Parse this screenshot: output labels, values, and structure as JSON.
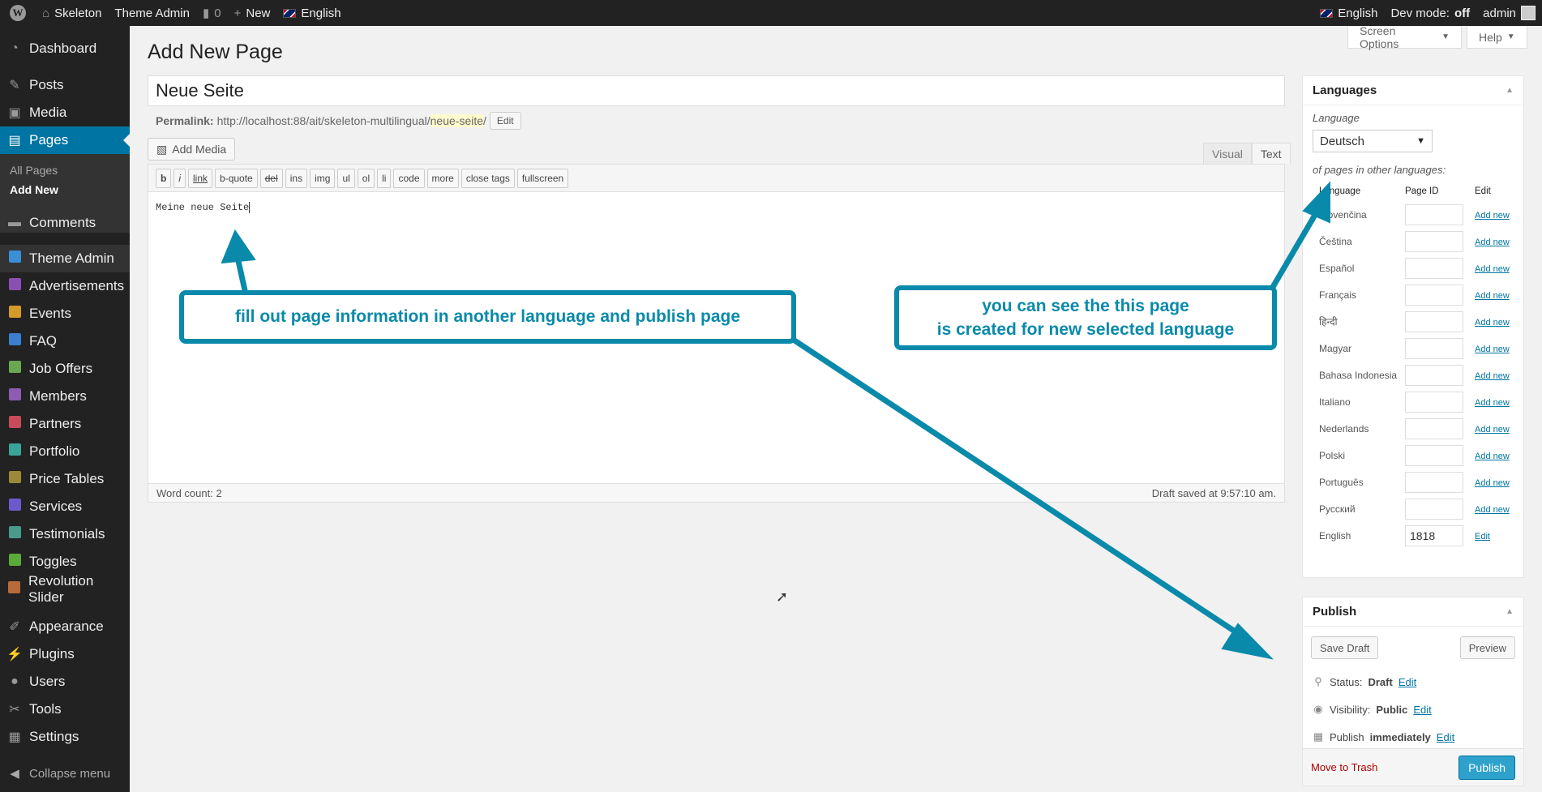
{
  "adminbar": {
    "site_name": "Skeleton",
    "theme_admin": "Theme Admin",
    "comments_count": "0",
    "new_label": "New",
    "language": "English",
    "right_language": "English",
    "dev_mode_label": "Dev mode:",
    "dev_mode_value": "off",
    "user": "admin"
  },
  "sidebar": {
    "items": [
      {
        "label": "Dashboard",
        "icon": "dashboard-icon"
      },
      {
        "label": "Posts",
        "icon": "pin-icon"
      },
      {
        "label": "Media",
        "icon": "media-icon"
      },
      {
        "label": "Pages",
        "icon": "pages-icon"
      },
      {
        "label": "Comments",
        "icon": "comment-icon"
      },
      {
        "label": "Theme Admin",
        "icon": "theme-admin-icon"
      },
      {
        "label": "Advertisements",
        "icon": "advertisements-icon"
      },
      {
        "label": "Events",
        "icon": "events-icon"
      },
      {
        "label": "FAQ",
        "icon": "faq-icon"
      },
      {
        "label": "Job Offers",
        "icon": "job-offers-icon"
      },
      {
        "label": "Members",
        "icon": "members-icon"
      },
      {
        "label": "Partners",
        "icon": "partners-icon"
      },
      {
        "label": "Portfolio",
        "icon": "portfolio-icon"
      },
      {
        "label": "Price Tables",
        "icon": "price-tables-icon"
      },
      {
        "label": "Services",
        "icon": "services-icon"
      },
      {
        "label": "Testimonials",
        "icon": "testimonials-icon"
      },
      {
        "label": "Toggles",
        "icon": "toggles-icon"
      },
      {
        "label": "Revolution Slider",
        "icon": "slider-icon"
      },
      {
        "label": "Appearance",
        "icon": "brush-icon"
      },
      {
        "label": "Plugins",
        "icon": "plugin-icon"
      },
      {
        "label": "Users",
        "icon": "user-icon"
      },
      {
        "label": "Tools",
        "icon": "wrench-icon"
      },
      {
        "label": "Settings",
        "icon": "settings-icon"
      }
    ],
    "submenu": [
      "All Pages",
      "Add New"
    ],
    "collapse_label": "Collapse menu"
  },
  "header": {
    "screen_options": "Screen Options",
    "help": "Help",
    "title": "Add New Page"
  },
  "editor": {
    "post_title": "Neue Seite",
    "permalink_label": "Permalink:",
    "permalink_base": "http://localhost:88/ait/skeleton-multilingual/",
    "permalink_slug": "neue-seite",
    "permalink_end": "/",
    "permalink_edit": "Edit",
    "add_media": "Add Media",
    "tab_visual": "Visual",
    "tab_text": "Text",
    "quicktags": [
      "b",
      "i",
      "link",
      "b-quote",
      "del",
      "ins",
      "img",
      "ul",
      "ol",
      "li",
      "code",
      "more",
      "close tags",
      "fullscreen"
    ],
    "content": "Meine neue Seite",
    "word_count": "Word count: 2",
    "draft_saved": "Draft saved at 9:57:10 am."
  },
  "languages_box": {
    "title": "Languages",
    "language_label": "Language",
    "selected_language": "Deutsch",
    "list_label": "of pages in other languages:",
    "col_language": "Language",
    "col_page_id": "Page ID",
    "col_edit": "Edit",
    "rows": [
      {
        "language": "Slovenčina",
        "page_id": "",
        "action": "Add new"
      },
      {
        "language": "Čeština",
        "page_id": "",
        "action": "Add new"
      },
      {
        "language": "Español",
        "page_id": "",
        "action": "Add new"
      },
      {
        "language": "Français",
        "page_id": "",
        "action": "Add new"
      },
      {
        "language": "हिन्दी",
        "page_id": "",
        "action": "Add new"
      },
      {
        "language": "Magyar",
        "page_id": "",
        "action": "Add new"
      },
      {
        "language": "Bahasa Indonesia",
        "page_id": "",
        "action": "Add new"
      },
      {
        "language": "Italiano",
        "page_id": "",
        "action": "Add new"
      },
      {
        "language": "Nederlands",
        "page_id": "",
        "action": "Add new"
      },
      {
        "language": "Polski",
        "page_id": "",
        "action": "Add new"
      },
      {
        "language": "Português",
        "page_id": "",
        "action": "Add new"
      },
      {
        "language": "Русский",
        "page_id": "",
        "action": "Add new"
      },
      {
        "language": "English",
        "page_id": "1818",
        "action": "Edit"
      }
    ]
  },
  "publish_box": {
    "title": "Publish",
    "save_draft": "Save Draft",
    "preview": "Preview",
    "status_label": "Status:",
    "status_value": "Draft",
    "visibility_label": "Visibility:",
    "visibility_value": "Public",
    "publish_label": "Publish",
    "publish_value": "immediately",
    "edit": "Edit",
    "move_to_trash": "Move to Trash",
    "publish_button": "Publish"
  },
  "annotations": {
    "left_callout": "fill out page information in another language and publish page",
    "right_callout_line1": "you can see the this page",
    "right_callout_line2": "is created for new selected language"
  },
  "colors": {
    "accent": "#0074a2",
    "annotation": "#0a8aaa",
    "sidebar_bg": "#222222"
  }
}
